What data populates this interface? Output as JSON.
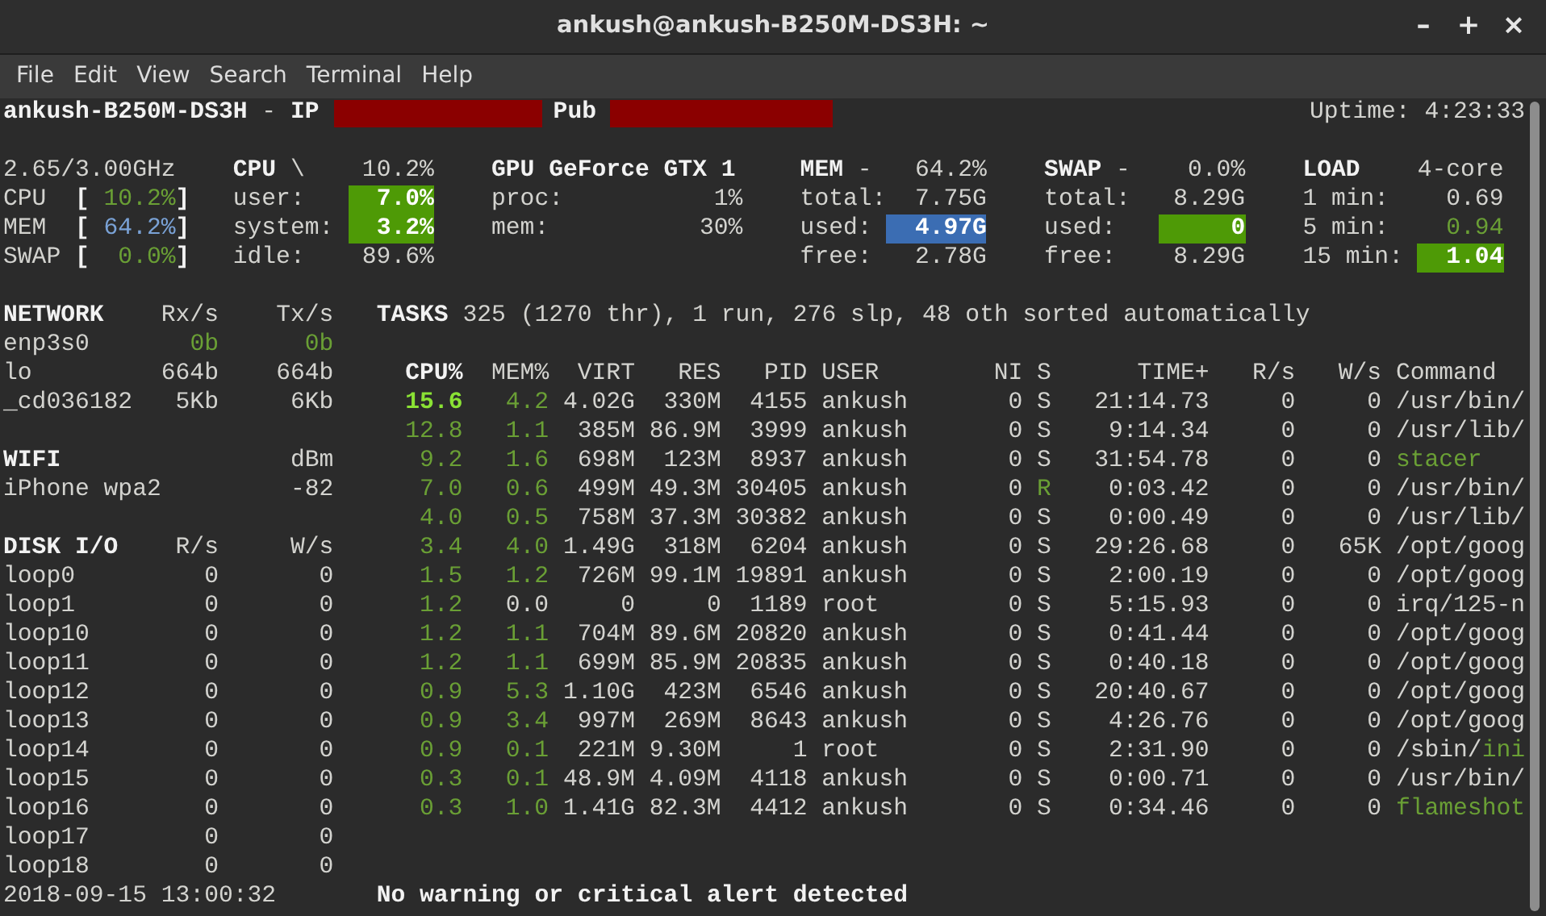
{
  "window": {
    "title": "ankush@ankush-B250M-DS3H: ~",
    "controls": [
      "–",
      "+",
      "×"
    ]
  },
  "menu": [
    "File",
    "Edit",
    "View",
    "Search",
    "Terminal",
    "Help"
  ],
  "header": {
    "hostname": "ankush-B250M-DS3H",
    "separator": "-",
    "ip_label": "IP",
    "ip_redacted": true,
    "pub_label": "Pub",
    "pub_redacted": true,
    "uptime": "Uptime: 4:23:33"
  },
  "quicklook": {
    "frequency": "2.65/3.00GHz",
    "rows": [
      {
        "label": "CPU",
        "open": "[",
        "value": "10.2%",
        "close": "]",
        "color": "#6a9f35"
      },
      {
        "label": "MEM",
        "open": "[",
        "value": "64.2%",
        "close": "]",
        "color": "#7aa2d6"
      },
      {
        "label": "SWAP",
        "open": "[",
        "value": "0.0%",
        "close": "]",
        "color": "#6a9f35"
      }
    ]
  },
  "panels": [
    {
      "title": "CPU",
      "sub": "\\",
      "summary": "10.2%",
      "rows": [
        {
          "label": "user:",
          "value": "7.0%",
          "color": "#4e9a06",
          "highlighted": true
        },
        {
          "label": "system:",
          "value": "3.2%",
          "color": "#4e9a06",
          "highlighted": true
        },
        {
          "label": "idle:",
          "value": "89.6%",
          "color": "#d3d3cf",
          "highlighted": false
        }
      ]
    },
    {
      "title": "GPU GeForce GTX 1",
      "rows": [
        {
          "label": "proc:",
          "value": "1%",
          "color": "#d3d3cf",
          "highlighted": false
        },
        {
          "label": "mem:",
          "value": "30%",
          "color": "#d3d3cf",
          "highlighted": false
        }
      ]
    },
    {
      "title": "MEM",
      "sub": "-",
      "summary": "64.2%",
      "rows": [
        {
          "label": "total:",
          "value": "7.75G",
          "color": "#d3d3cf",
          "highlighted": false
        },
        {
          "label": "used:",
          "value": "4.97G",
          "color": "#3b6db3",
          "highlighted": true
        },
        {
          "label": "free:",
          "value": "2.78G",
          "color": "#d3d3cf",
          "highlighted": false
        }
      ]
    },
    {
      "title": "SWAP",
      "sub": "-",
      "summary": "0.0%",
      "rows": [
        {
          "label": "total:",
          "value": "8.29G",
          "color": "#d3d3cf",
          "highlighted": false
        },
        {
          "label": "used:",
          "value": "0",
          "color": "#4e9a06",
          "highlighted": true
        },
        {
          "label": "free:",
          "value": "8.29G",
          "color": "#d3d3cf",
          "highlighted": false
        }
      ]
    },
    {
      "title": "LOAD",
      "summary": "4-core",
      "rows": [
        {
          "label": "1 min:",
          "value": "0.69",
          "color": "#d3d3cf",
          "highlighted": false
        },
        {
          "label": "5 min:",
          "value": "0.94",
          "color": "#6a9f35",
          "highlighted": false
        },
        {
          "label": "15 min:",
          "value": "1.04",
          "color": "#4e9a06",
          "highlighted": true
        }
      ]
    }
  ],
  "network": {
    "title": "NETWORK",
    "col_1": "Rx/s",
    "col_2": "Tx/s",
    "rows": [
      {
        "name": "enp3s0",
        "rx": "0b",
        "tx": "0b",
        "color": "#6a9f35"
      },
      {
        "name": "lo",
        "rx": "664b",
        "tx": "664b",
        "color": "#d3d3cf"
      },
      {
        "name": "_cd036182",
        "rx": "5Kb",
        "tx": "6Kb",
        "color": "#d3d3cf"
      }
    ]
  },
  "wifi": {
    "title": "WIFI",
    "unit": "dBm",
    "rows": [
      {
        "name": "iPhone wpa2",
        "value": "-82"
      }
    ]
  },
  "disk": {
    "title": "DISK I/O",
    "col_1": "R/s",
    "col_2": "W/s",
    "rows": [
      {
        "name": "loop0",
        "r": "0",
        "w": "0"
      },
      {
        "name": "loop1",
        "r": "0",
        "w": "0"
      },
      {
        "name": "loop10",
        "r": "0",
        "w": "0"
      },
      {
        "name": "loop11",
        "r": "0",
        "w": "0"
      },
      {
        "name": "loop12",
        "r": "0",
        "w": "0"
      },
      {
        "name": "loop13",
        "r": "0",
        "w": "0"
      },
      {
        "name": "loop14",
        "r": "0",
        "w": "0"
      },
      {
        "name": "loop15",
        "r": "0",
        "w": "0"
      },
      {
        "name": "loop16",
        "r": "0",
        "w": "0"
      },
      {
        "name": "loop17",
        "r": "0",
        "w": "0"
      },
      {
        "name": "loop18",
        "r": "0",
        "w": "0"
      }
    ]
  },
  "tasks": {
    "label": "TASKS",
    "summary": "325 (1270 thr), 1 run, 276 slp, 48 oth sorted automatically"
  },
  "processes": {
    "columns": [
      {
        "label": "CPU%",
        "sorted": true
      },
      {
        "label": "MEM%",
        "sorted": false
      },
      {
        "label": "VIRT",
        "sorted": false
      },
      {
        "label": "RES",
        "sorted": false
      },
      {
        "label": "PID",
        "sorted": false
      },
      {
        "label": "USER",
        "sorted": false
      },
      {
        "label": "NI",
        "sorted": false
      },
      {
        "label": "S",
        "sorted": false
      },
      {
        "label": "TIME+",
        "sorted": false
      },
      {
        "label": "R/s",
        "sorted": false
      },
      {
        "label": "W/s",
        "sorted": false
      },
      {
        "label": "Command",
        "sorted": false
      }
    ],
    "rows": [
      {
        "cpu": {
          "value": "15.6",
          "color": "#8ae234",
          "bold": true
        },
        "mem": {
          "value": "4.2",
          "color": "#6a9f35"
        },
        "virt": "4.02G",
        "res": "330M",
        "pid": "4155",
        "user": "ankush",
        "ni": "0",
        "s": {
          "value": "S",
          "color": "#d3d3cf"
        },
        "time": "21:14.73",
        "r": "0",
        "w": "0",
        "command": {
          "path": "/usr/bin/"
        }
      },
      {
        "cpu": {
          "value": "12.8",
          "color": "#6a9f35",
          "bold": false
        },
        "mem": {
          "value": "1.1",
          "color": "#6a9f35"
        },
        "virt": "385M",
        "res": "86.9M",
        "pid": "3999",
        "user": "ankush",
        "ni": "0",
        "s": {
          "value": "S",
          "color": "#d3d3cf"
        },
        "time": "9:14.34",
        "r": "0",
        "w": "0",
        "command": {
          "path": "/usr/lib/"
        }
      },
      {
        "cpu": {
          "value": "9.2",
          "color": "#6a9f35",
          "bold": false
        },
        "mem": {
          "value": "1.6",
          "color": "#6a9f35"
        },
        "virt": "698M",
        "res": "123M",
        "pid": "8937",
        "user": "ankush",
        "ni": "0",
        "s": {
          "value": "S",
          "color": "#d3d3cf"
        },
        "time": "31:54.78",
        "r": "0",
        "w": "0",
        "command": {
          "name": "stacer",
          "color": "#6a9f35"
        }
      },
      {
        "cpu": {
          "value": "7.0",
          "color": "#6a9f35",
          "bold": false
        },
        "mem": {
          "value": "0.6",
          "color": "#6a9f35"
        },
        "virt": "499M",
        "res": "49.3M",
        "pid": "30405",
        "user": "ankush",
        "ni": "0",
        "s": {
          "value": "R",
          "color": "#6a9f35"
        },
        "time": "0:03.42",
        "r": "0",
        "w": "0",
        "command": {
          "path": "/usr/bin/"
        }
      },
      {
        "cpu": {
          "value": "4.0",
          "color": "#6a9f35",
          "bold": false
        },
        "mem": {
          "value": "0.5",
          "color": "#6a9f35"
        },
        "virt": "758M",
        "res": "37.3M",
        "pid": "30382",
        "user": "ankush",
        "ni": "0",
        "s": {
          "value": "S",
          "color": "#d3d3cf"
        },
        "time": "0:00.49",
        "r": "0",
        "w": "0",
        "command": {
          "path": "/usr/lib/"
        }
      },
      {
        "cpu": {
          "value": "3.4",
          "color": "#6a9f35",
          "bold": false
        },
        "mem": {
          "value": "4.0",
          "color": "#6a9f35"
        },
        "virt": "1.49G",
        "res": "318M",
        "pid": "6204",
        "user": "ankush",
        "ni": "0",
        "s": {
          "value": "S",
          "color": "#d3d3cf"
        },
        "time": "29:26.68",
        "r": "0",
        "w": "65K",
        "command": {
          "path": "/opt/goog"
        }
      },
      {
        "cpu": {
          "value": "1.5",
          "color": "#6a9f35",
          "bold": false
        },
        "mem": {
          "value": "1.2",
          "color": "#6a9f35"
        },
        "virt": "726M",
        "res": "99.1M",
        "pid": "19891",
        "user": "ankush",
        "ni": "0",
        "s": {
          "value": "S",
          "color": "#d3d3cf"
        },
        "time": "2:00.19",
        "r": "0",
        "w": "0",
        "command": {
          "path": "/opt/goog"
        }
      },
      {
        "cpu": {
          "value": "1.2",
          "color": "#6a9f35",
          "bold": false
        },
        "mem": {
          "value": "0.0",
          "color": "#d3d3cf"
        },
        "virt": "0",
        "res": "0",
        "pid": "1189",
        "user": "root",
        "ni": "0",
        "s": {
          "value": "S",
          "color": "#d3d3cf"
        },
        "time": "5:15.93",
        "r": "0",
        "w": "0",
        "command": {
          "path": "irq/125-n"
        }
      },
      {
        "cpu": {
          "value": "1.2",
          "color": "#6a9f35",
          "bold": false
        },
        "mem": {
          "value": "1.1",
          "color": "#6a9f35"
        },
        "virt": "704M",
        "res": "89.6M",
        "pid": "20820",
        "user": "ankush",
        "ni": "0",
        "s": {
          "value": "S",
          "color": "#d3d3cf"
        },
        "time": "0:41.44",
        "r": "0",
        "w": "0",
        "command": {
          "path": "/opt/goog"
        }
      },
      {
        "cpu": {
          "value": "1.2",
          "color": "#6a9f35",
          "bold": false
        },
        "mem": {
          "value": "1.1",
          "color": "#6a9f35"
        },
        "virt": "699M",
        "res": "85.9M",
        "pid": "20835",
        "user": "ankush",
        "ni": "0",
        "s": {
          "value": "S",
          "color": "#d3d3cf"
        },
        "time": "0:40.18",
        "r": "0",
        "w": "0",
        "command": {
          "path": "/opt/goog"
        }
      },
      {
        "cpu": {
          "value": "0.9",
          "color": "#6a9f35",
          "bold": false
        },
        "mem": {
          "value": "5.3",
          "color": "#6a9f35"
        },
        "virt": "1.10G",
        "res": "423M",
        "pid": "6546",
        "user": "ankush",
        "ni": "0",
        "s": {
          "value": "S",
          "color": "#d3d3cf"
        },
        "time": "20:40.67",
        "r": "0",
        "w": "0",
        "command": {
          "path": "/opt/goog"
        }
      },
      {
        "cpu": {
          "value": "0.9",
          "color": "#6a9f35",
          "bold": false
        },
        "mem": {
          "value": "3.4",
          "color": "#6a9f35"
        },
        "virt": "997M",
        "res": "269M",
        "pid": "8643",
        "user": "ankush",
        "ni": "0",
        "s": {
          "value": "S",
          "color": "#d3d3cf"
        },
        "time": "4:26.76",
        "r": "0",
        "w": "0",
        "command": {
          "path": "/opt/goog"
        }
      },
      {
        "cpu": {
          "value": "0.9",
          "color": "#6a9f35",
          "bold": false
        },
        "mem": {
          "value": "0.1",
          "color": "#6a9f35"
        },
        "virt": "221M",
        "res": "9.30M",
        "pid": "1",
        "user": "root",
        "ni": "0",
        "s": {
          "value": "S",
          "color": "#d3d3cf"
        },
        "time": "2:31.90",
        "r": "0",
        "w": "0",
        "command": {
          "path": "/sbin/",
          "name": "ini",
          "color": "#6a9f35"
        }
      },
      {
        "cpu": {
          "value": "0.3",
          "color": "#6a9f35",
          "bold": false
        },
        "mem": {
          "value": "0.1",
          "color": "#6a9f35"
        },
        "virt": "48.9M",
        "res": "4.09M",
        "pid": "4118",
        "user": "ankush",
        "ni": "0",
        "s": {
          "value": "S",
          "color": "#d3d3cf"
        },
        "time": "0:00.71",
        "r": "0",
        "w": "0",
        "command": {
          "path": "/usr/bin/"
        }
      },
      {
        "cpu": {
          "value": "0.3",
          "color": "#6a9f35",
          "bold": false
        },
        "mem": {
          "value": "1.0",
          "color": "#6a9f35"
        },
        "virt": "1.41G",
        "res": "82.3M",
        "pid": "4412",
        "user": "ankush",
        "ni": "0",
        "s": {
          "value": "S",
          "color": "#d3d3cf"
        },
        "time": "0:34.46",
        "r": "0",
        "w": "0",
        "command": {
          "name": "flameshot",
          "color": "#6a9f35"
        }
      }
    ]
  },
  "footer": {
    "datetime": "2018-09-15 13:00:32",
    "alert": "No warning or critical alert detected"
  }
}
